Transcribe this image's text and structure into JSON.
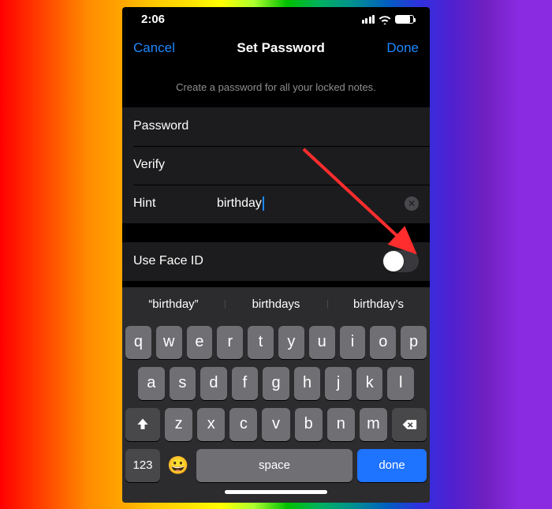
{
  "status": {
    "time": "2:06"
  },
  "nav": {
    "cancel": "Cancel",
    "title": "Set Password",
    "done": "Done"
  },
  "subtitle": "Create a password for all your locked notes.",
  "form": {
    "password_label": "Password",
    "verify_label": "Verify",
    "hint_label": "Hint",
    "hint_value": "birthday",
    "faceid_label": "Use Face ID",
    "faceid_on": false
  },
  "suggestions": [
    "“birthday”",
    "birthdays",
    "birthday’s"
  ],
  "keyboard": {
    "row1": [
      "q",
      "w",
      "e",
      "r",
      "t",
      "y",
      "u",
      "i",
      "o",
      "p"
    ],
    "row2": [
      "a",
      "s",
      "d",
      "f",
      "g",
      "h",
      "j",
      "k",
      "l"
    ],
    "row3": [
      "z",
      "x",
      "c",
      "v",
      "b",
      "n",
      "m"
    ],
    "num": "123",
    "space": "space",
    "done": "done"
  }
}
